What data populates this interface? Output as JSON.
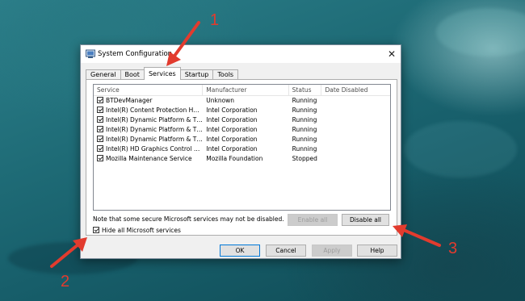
{
  "window": {
    "title": "System Configuration",
    "close_glyph": "✕"
  },
  "tabs": [
    {
      "label": "General",
      "active": false
    },
    {
      "label": "Boot",
      "active": false
    },
    {
      "label": "Services",
      "active": true
    },
    {
      "label": "Startup",
      "active": false
    },
    {
      "label": "Tools",
      "active": false
    }
  ],
  "services": {
    "columns": [
      "Service",
      "Manufacturer",
      "Status",
      "Date Disabled"
    ],
    "rows": [
      {
        "checked": true,
        "service": "BTDevManager",
        "manufacturer": "Unknown",
        "status": "Running",
        "date_disabled": ""
      },
      {
        "checked": true,
        "service": "Intel(R) Content Protection HEC...",
        "manufacturer": "Intel Corporation",
        "status": "Running",
        "date_disabled": ""
      },
      {
        "checked": true,
        "service": "Intel(R) Dynamic Platform & The...",
        "manufacturer": "Intel Corporation",
        "status": "Running",
        "date_disabled": ""
      },
      {
        "checked": true,
        "service": "Intel(R) Dynamic Platform & The...",
        "manufacturer": "Intel Corporation",
        "status": "Running",
        "date_disabled": ""
      },
      {
        "checked": true,
        "service": "Intel(R) Dynamic Platform & The...",
        "manufacturer": "Intel Corporation",
        "status": "Running",
        "date_disabled": ""
      },
      {
        "checked": true,
        "service": "Intel(R) HD Graphics Control Pa...",
        "manufacturer": "Intel Corporation",
        "status": "Running",
        "date_disabled": ""
      },
      {
        "checked": true,
        "service": "Mozilla Maintenance Service",
        "manufacturer": "Mozilla Foundation",
        "status": "Stopped",
        "date_disabled": ""
      }
    ],
    "note": "Note that some secure Microsoft services may not be disabled.",
    "enable_all_label": "Enable all",
    "disable_all_label": "Disable all",
    "hide_ms_label": "Hide all Microsoft services",
    "hide_ms_checked": true
  },
  "footer": {
    "ok_label": "OK",
    "cancel_label": "Cancel",
    "apply_label": "Apply",
    "help_label": "Help"
  },
  "annotations": {
    "color": "#e23b2e",
    "numbers": [
      "1",
      "2",
      "3"
    ]
  }
}
